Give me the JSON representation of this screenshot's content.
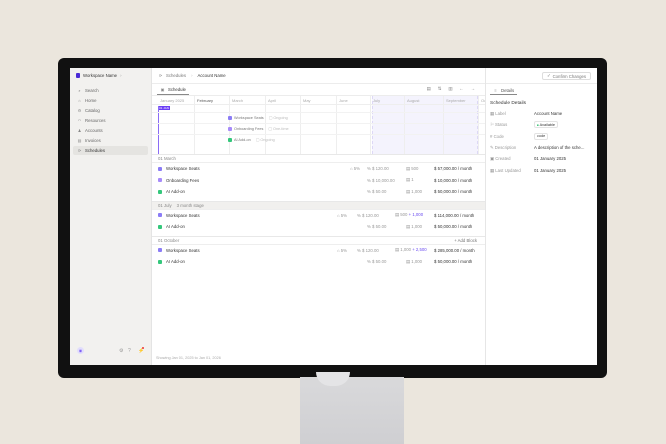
{
  "workspace": "Workspace Name",
  "sidebar": {
    "items": [
      {
        "label": "Search",
        "icon": "search"
      },
      {
        "label": "Home",
        "icon": "home"
      },
      {
        "label": "Catalog",
        "icon": "catalog"
      },
      {
        "label": "Resources",
        "icon": "resources"
      },
      {
        "label": "Accounts",
        "icon": "accounts"
      },
      {
        "label": "Invoices",
        "icon": "invoices"
      },
      {
        "label": "Schedules",
        "icon": "schedules",
        "active": true
      }
    ]
  },
  "breadcrumb": [
    "Schedules",
    "Account Name"
  ],
  "confirm_label": "Confirm Changes",
  "tab": "Schedule",
  "today_label": "01 JAN",
  "months": [
    "January 2025",
    "February",
    "March",
    "April",
    "May",
    "June",
    "July",
    "August",
    "September",
    "Oc"
  ],
  "gantt": [
    {
      "name": "Workspace Seats",
      "tag": "Ongoing",
      "color": "#8b7cf6"
    },
    {
      "name": "Onboarding Fees",
      "tag": "One-time",
      "color": "#a78bfa"
    },
    {
      "name": "AI Add-on",
      "tag": "Ongoing",
      "color": "#34c77b"
    }
  ],
  "sections": [
    {
      "title": "01 March",
      "sub": "",
      "rows": [
        {
          "name": "Workspace Seats",
          "color": "#8b7cf6",
          "discount": "5%",
          "price": "$ 120.00",
          "qty": "500",
          "qty_add": "",
          "total": "57,000.00 / month"
        },
        {
          "name": "Onboarding Fees",
          "color": "#a78bfa",
          "discount": "",
          "price": "$ 10,000.00",
          "qty": "1",
          "qty_add": "",
          "total": "10,000.00 / month"
        },
        {
          "name": "AI Add-on",
          "color": "#34c77b",
          "discount": "",
          "price": "$ 50.00",
          "qty": "1,000",
          "qty_add": "",
          "total": "50,000.00 / month"
        }
      ]
    },
    {
      "title": "01 July",
      "sub": "3 month stage",
      "rows": [
        {
          "name": "Workspace Seats",
          "color": "#8b7cf6",
          "discount": "5%",
          "price": "$ 120.00",
          "qty": "500",
          "qty_add": "+ 1,000",
          "total": "114,000.00 / month"
        },
        {
          "name": "AI Add-on",
          "color": "#34c77b",
          "discount": "",
          "price": "$ 50.00",
          "qty": "1,000",
          "qty_add": "",
          "total": "50,000.00 / month"
        }
      ]
    },
    {
      "title": "01 October",
      "sub": "",
      "action": "+ Add Block",
      "rows": [
        {
          "name": "Workspace Seats",
          "color": "#8b7cf6",
          "discount": "5%",
          "price": "$ 120.00",
          "qty": "1,000",
          "qty_add": "+ 2,500",
          "total": "285,000.00 / month"
        },
        {
          "name": "AI Add-on",
          "color": "#34c77b",
          "discount": "",
          "price": "$ 50.00",
          "qty": "1,000",
          "qty_add": "",
          "total": "50,000.00 / month"
        }
      ]
    }
  ],
  "footer": "Showing Jan 01, 2025 to Jan 01, 2026",
  "details": {
    "tab": "Details",
    "title": "Schedule Details",
    "fields": [
      {
        "label": "Label",
        "value": "Account Name"
      },
      {
        "label": "Status",
        "value": "Available",
        "badge": true
      },
      {
        "label": "Code",
        "value": "code",
        "chip": true
      },
      {
        "label": "Description",
        "value": "A description of the sche..."
      },
      {
        "label": "Created",
        "value": "01 January 2025"
      },
      {
        "label": "Last Updated",
        "value": "01 January 2025"
      }
    ]
  },
  "colors": {
    "accent": "#7c5cf6",
    "status": "#2bbf6a"
  }
}
